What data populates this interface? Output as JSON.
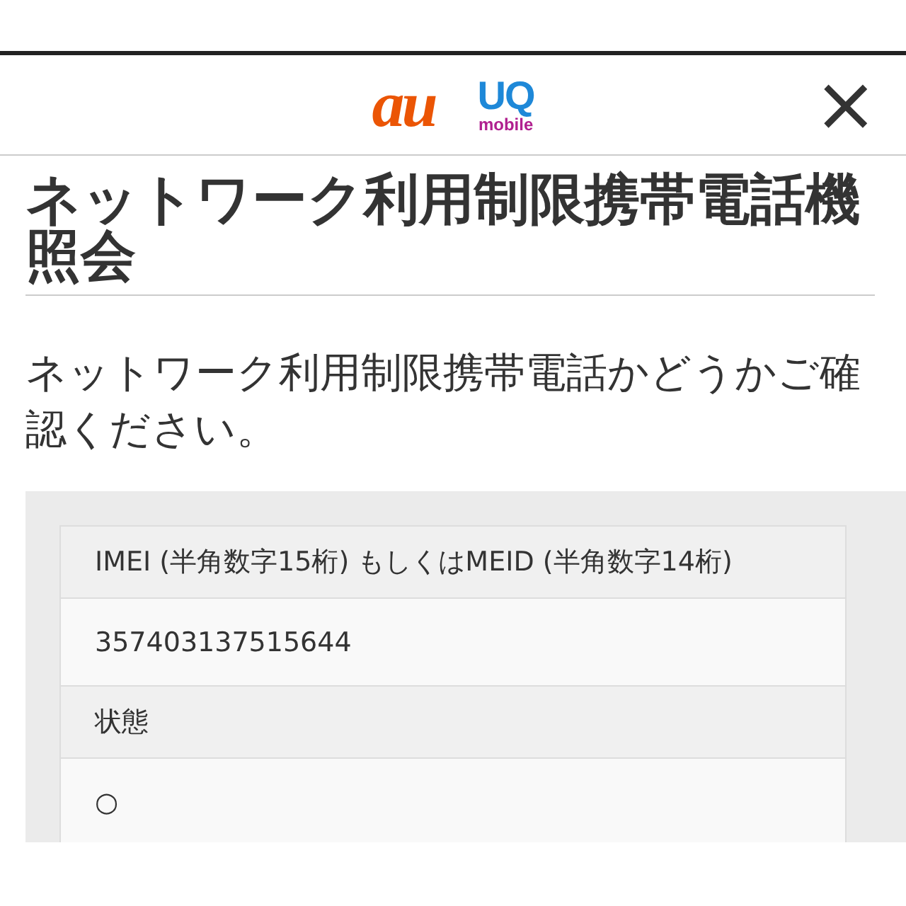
{
  "header": {
    "logos": [
      {
        "kind": "au",
        "text": "au"
      },
      {
        "kind": "uq",
        "text": "UQ",
        "subtext": "mobile"
      }
    ],
    "close": "×"
  },
  "title": "ネットワーク利用制限携帯電話機照会",
  "description": "ネットワーク利用制限携帯電話かどうかご確認ください。",
  "result_table": [
    {
      "kind": "label",
      "text": "IMEI (半角数字15桁) もしくはMEID (半角数字14桁)"
    },
    {
      "kind": "value",
      "text": "357403137515644"
    },
    {
      "kind": "label",
      "text": "状態"
    },
    {
      "kind": "value",
      "text": "○"
    }
  ]
}
